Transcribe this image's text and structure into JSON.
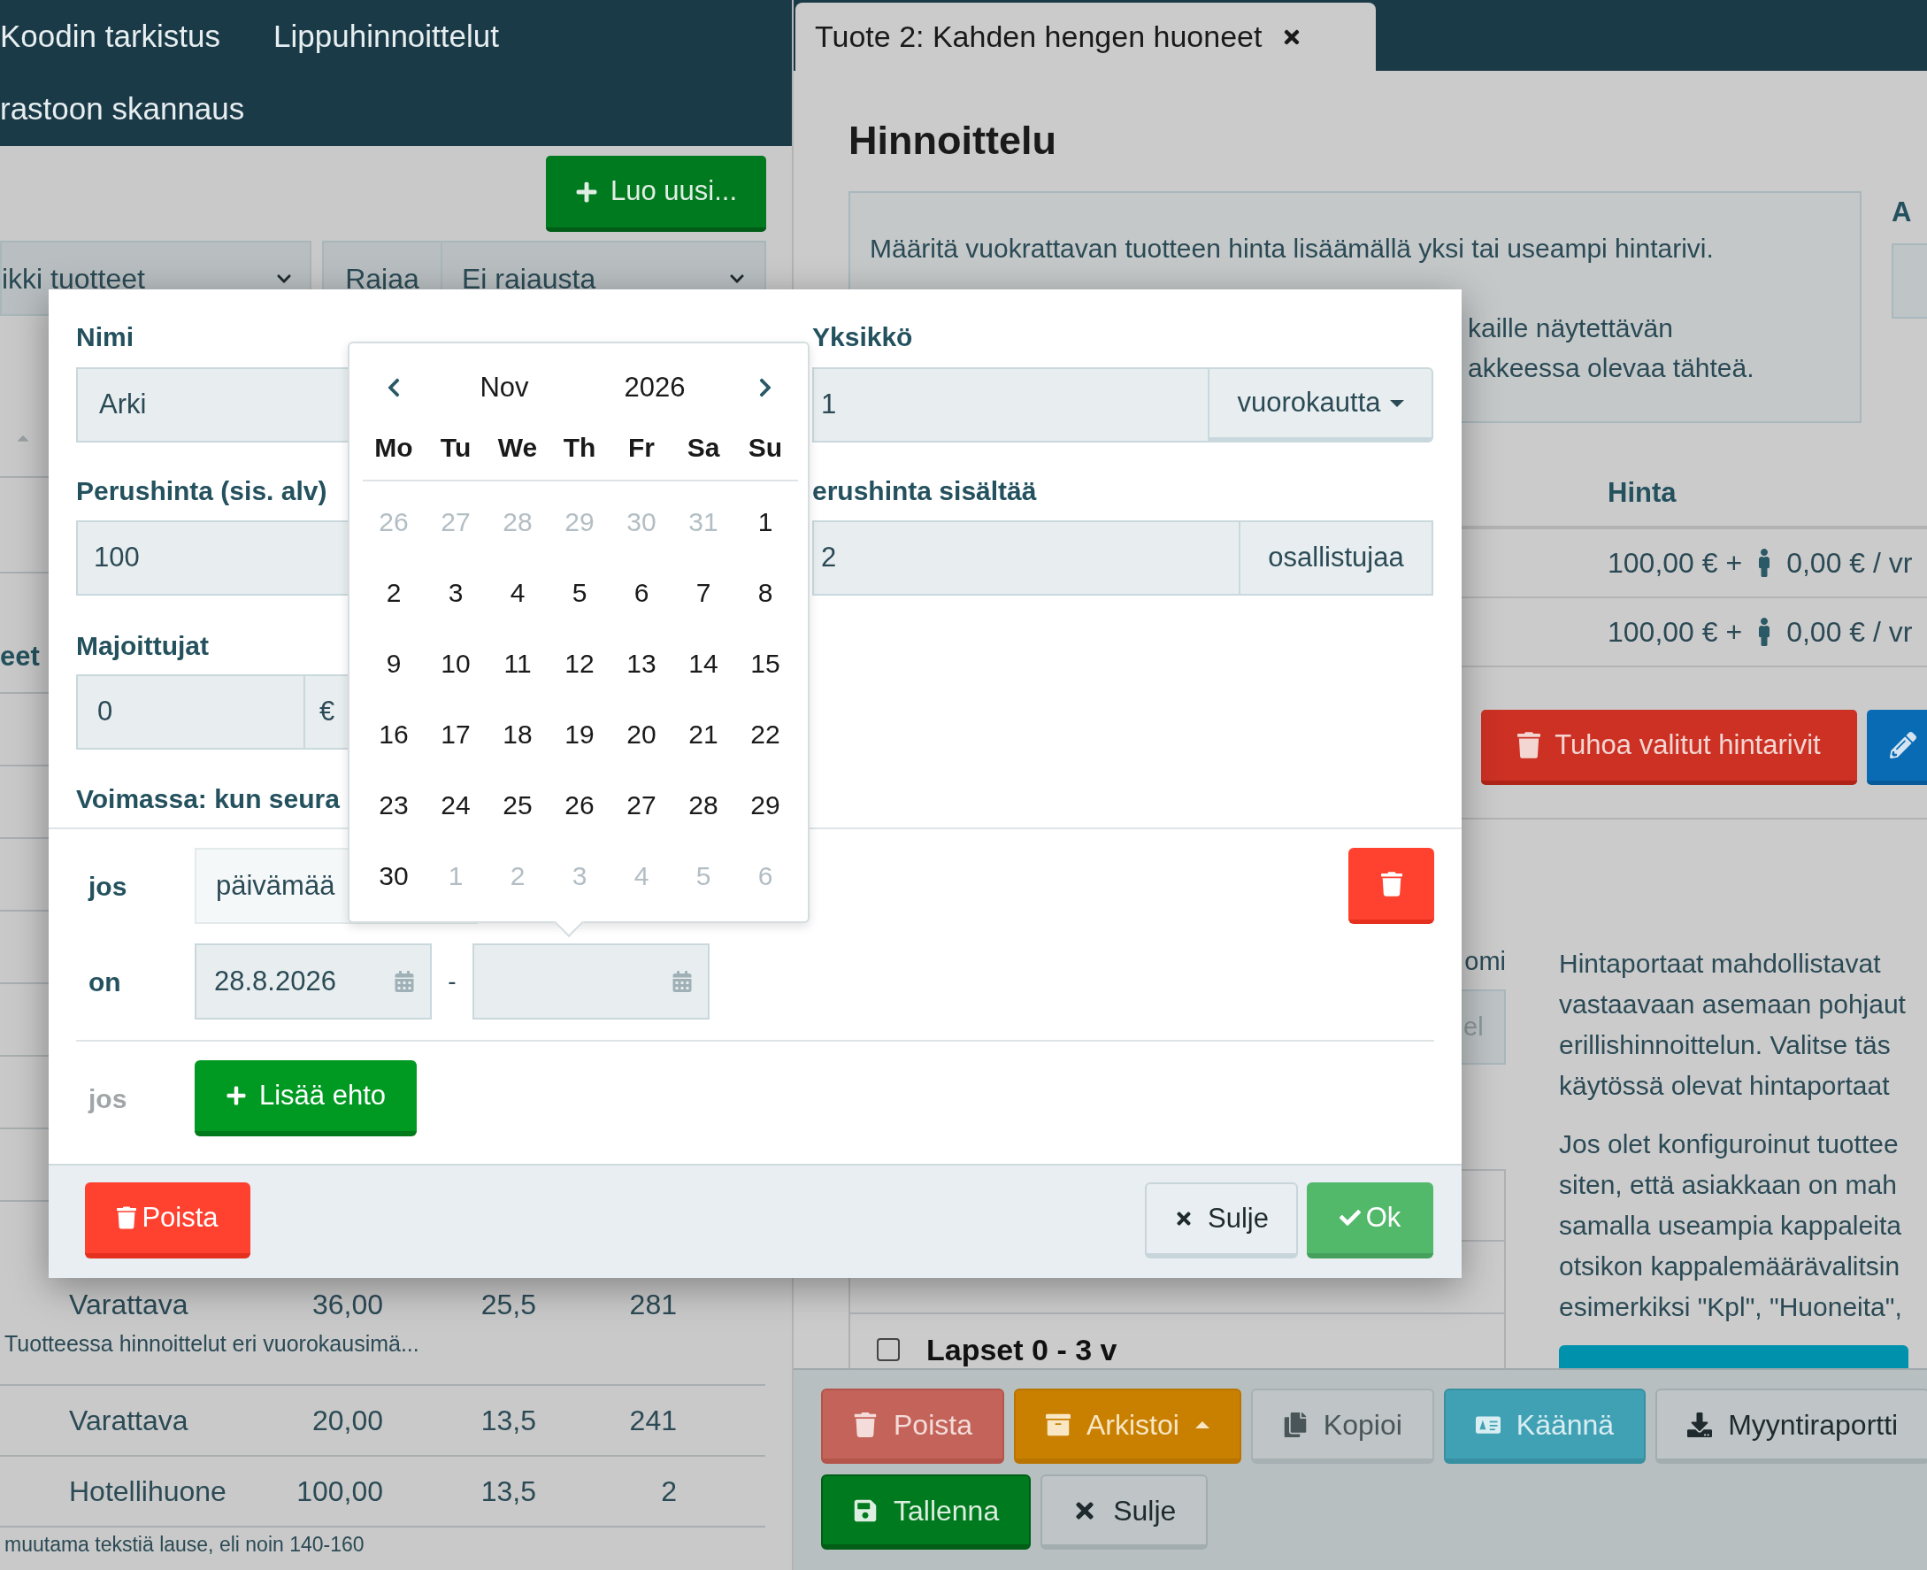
{
  "left_panel": {
    "nav_rows": [
      {
        "items": [
          "Koodin tarkistus",
          "Lippuhinnoittelut"
        ]
      },
      {
        "items": [
          "rastoon skannaus"
        ]
      }
    ],
    "create_button": "Luo uusi...",
    "filters": {
      "product_select": "ikki tuotteet",
      "filter_label": "Rajaa",
      "filter_select": "Ei rajausta"
    },
    "column_fragment": "eet",
    "rows": [
      {
        "cells": [
          "Varattava",
          "36,00",
          "25,5",
          "281"
        ],
        "note": "Tuotteessa hinnoittelut eri vuorokausimä..."
      },
      {
        "cells": [
          "Varattava",
          "20,00",
          "13,5",
          "241"
        ]
      },
      {
        "cells": [
          "Hotellihuone",
          "100,00",
          "13,5",
          "2"
        ]
      }
    ],
    "trailing_text": "muutama tekstiä lause, eli noin 140-160"
  },
  "right_panel": {
    "tabs": [
      {
        "label": "Tuote 2: Kahden hengen huoneet",
        "selected": true
      }
    ],
    "heading": "Hinnoittelu",
    "info_lines": [
      "Määritä vuokrattavan tuotteen hinta lisäämällä yksi tai useampi hintarivi.",
      "kaille näytettävän",
      "akkeessa olevaa tähteä."
    ],
    "side_label": "A",
    "price_table": {
      "header": "Hinta",
      "rows": [
        {
          "base": "100,00 € +",
          "per_person": "0,00 € / vr"
        },
        {
          "base": "100,00 € +",
          "per_person": "0,00 € / vr"
        }
      ],
      "delete_button": "Tuhoa valitut hintarivit"
    },
    "field_label_fragment": "omi",
    "field_value_fragment": "el",
    "checklist": [
      {
        "label": "Lapset 0 - 3 v",
        "checked": false
      }
    ],
    "paragraphs": [
      {
        "lines": [
          "Hintaportaat mahdollistavat",
          "vastaavaan asemaan pohjaut",
          "erillishinnoittelun. Valitse täs",
          "käytössä olevat hintaportaat"
        ]
      },
      {
        "lines": [
          "Jos olet konfiguroinut tuottee",
          "siten, että asiakkaan on mah",
          "samalla useampia kappaleita",
          "otsikon kappalemäärävalitsin",
          "esimerkiksi \"Kpl\", \"Huoneita\","
        ]
      }
    ],
    "actions": [
      {
        "row": [
          {
            "kind": "delete",
            "label": "Poista"
          },
          {
            "kind": "archive",
            "label": "Arkistoi",
            "menu": true
          },
          {
            "kind": "copy",
            "label": "Kopioi"
          },
          {
            "kind": "translate",
            "label": "Käännä"
          },
          {
            "kind": "report",
            "label": "Myyntiraportti"
          }
        ]
      },
      {
        "row": [
          {
            "kind": "save",
            "label": "Tallenna"
          },
          {
            "kind": "close",
            "label": "Sulje"
          }
        ]
      }
    ]
  },
  "modal": {
    "name": {
      "label": "Nimi",
      "value": "Arki"
    },
    "base_price": {
      "label": "Perushinta (sis. alv)",
      "value": "100"
    },
    "guests": {
      "label": "Majoittujat",
      "value": "0",
      "addon": "€"
    },
    "validity_label": "Voimassa: kun seura",
    "unit": {
      "label": "Yksikkö",
      "value": "1",
      "unit": "vuorokautta"
    },
    "included": {
      "label": "erushinta sisältää",
      "value": "2",
      "addon": "osallistujaa"
    },
    "condition": {
      "prefix": "jos",
      "select": "päivämää"
    },
    "range": {
      "prefix": "on",
      "from": "28.8.2026",
      "separator": "-"
    },
    "add_condition": {
      "prefix": "jos",
      "button": "Lisää ehto"
    },
    "footer": {
      "delete": "Poista",
      "close": "Sulje",
      "ok": "Ok"
    },
    "datepicker": {
      "month": "Nov",
      "year": "2026",
      "weekdays": [
        "Mo",
        "Tu",
        "We",
        "Th",
        "Fr",
        "Sa",
        "Su"
      ],
      "weeks": [
        {
          "days": [
            {
              "day": "26",
              "outside": true
            },
            {
              "day": "27",
              "outside": true
            },
            {
              "day": "28",
              "outside": true
            },
            {
              "day": "29",
              "outside": true
            },
            {
              "day": "30",
              "outside": true
            },
            {
              "day": "31",
              "outside": true
            },
            {
              "day": "1",
              "outside": false
            }
          ]
        },
        {
          "days": [
            {
              "day": "2",
              "outside": false
            },
            {
              "day": "3",
              "outside": false
            },
            {
              "day": "4",
              "outside": false
            },
            {
              "day": "5",
              "outside": false
            },
            {
              "day": "6",
              "outside": false
            },
            {
              "day": "7",
              "outside": false
            },
            {
              "day": "8",
              "outside": false
            }
          ]
        },
        {
          "days": [
            {
              "day": "9",
              "outside": false
            },
            {
              "day": "10",
              "outside": false
            },
            {
              "day": "11",
              "outside": false
            },
            {
              "day": "12",
              "outside": false
            },
            {
              "day": "13",
              "outside": false
            },
            {
              "day": "14",
              "outside": false
            },
            {
              "day": "15",
              "outside": false
            }
          ]
        },
        {
          "days": [
            {
              "day": "16",
              "outside": false
            },
            {
              "day": "17",
              "outside": false
            },
            {
              "day": "18",
              "outside": false
            },
            {
              "day": "19",
              "outside": false
            },
            {
              "day": "20",
              "outside": false
            },
            {
              "day": "21",
              "outside": false
            },
            {
              "day": "22",
              "outside": false
            }
          ]
        },
        {
          "days": [
            {
              "day": "23",
              "outside": false
            },
            {
              "day": "24",
              "outside": false
            },
            {
              "day": "25",
              "outside": false
            },
            {
              "day": "26",
              "outside": false
            },
            {
              "day": "27",
              "outside": false
            },
            {
              "day": "28",
              "outside": false
            },
            {
              "day": "29",
              "outside": false
            }
          ]
        },
        {
          "days": [
            {
              "day": "30",
              "outside": false
            },
            {
              "day": "1",
              "outside": true
            },
            {
              "day": "2",
              "outside": true
            },
            {
              "day": "3",
              "outside": true
            },
            {
              "day": "4",
              "outside": true
            },
            {
              "day": "5",
              "outside": true
            },
            {
              "day": "6",
              "outside": true
            }
          ]
        }
      ]
    }
  }
}
